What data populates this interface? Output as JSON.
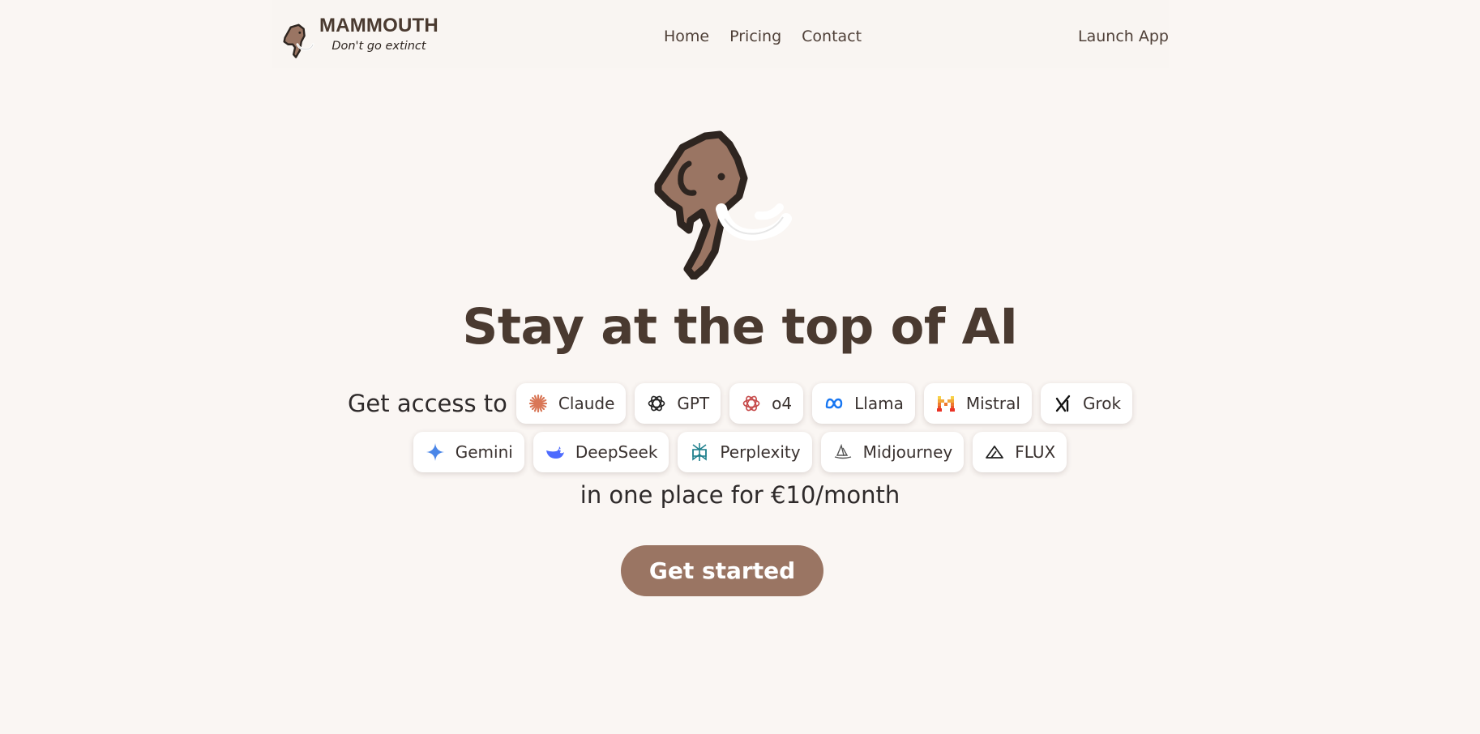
{
  "header": {
    "brand_name": "MAMMOUTH",
    "tagline": "Don't go extinct",
    "nav": [
      {
        "label": "Home"
      },
      {
        "label": "Pricing"
      },
      {
        "label": "Contact"
      }
    ],
    "launch_label": "Launch App"
  },
  "hero": {
    "headline": "Stay at the top of AI",
    "intro": "Get access to",
    "models_row1": [
      {
        "label": "Claude",
        "icon": "claude-icon"
      },
      {
        "label": "GPT",
        "icon": "openai-icon"
      },
      {
        "label": "o4",
        "icon": "openai-icon"
      },
      {
        "label": "Llama",
        "icon": "meta-icon"
      },
      {
        "label": "Mistral",
        "icon": "mistral-icon"
      },
      {
        "label": "Grok",
        "icon": "grok-icon"
      }
    ],
    "models_row2": [
      {
        "label": "Gemini",
        "icon": "gemini-icon"
      },
      {
        "label": "DeepSeek",
        "icon": "deepseek-icon"
      },
      {
        "label": "Perplexity",
        "icon": "perplexity-icon"
      },
      {
        "label": "Midjourney",
        "icon": "midjourney-icon"
      },
      {
        "label": "FLUX",
        "icon": "flux-icon"
      }
    ],
    "outro": "in one place for €10/month",
    "cta_label": "Get started"
  },
  "colors": {
    "background": "#faf6f3",
    "brand_brown": "#4a3a30",
    "button_brown": "#9a7563",
    "mammoth_fur": "#9a7563"
  }
}
